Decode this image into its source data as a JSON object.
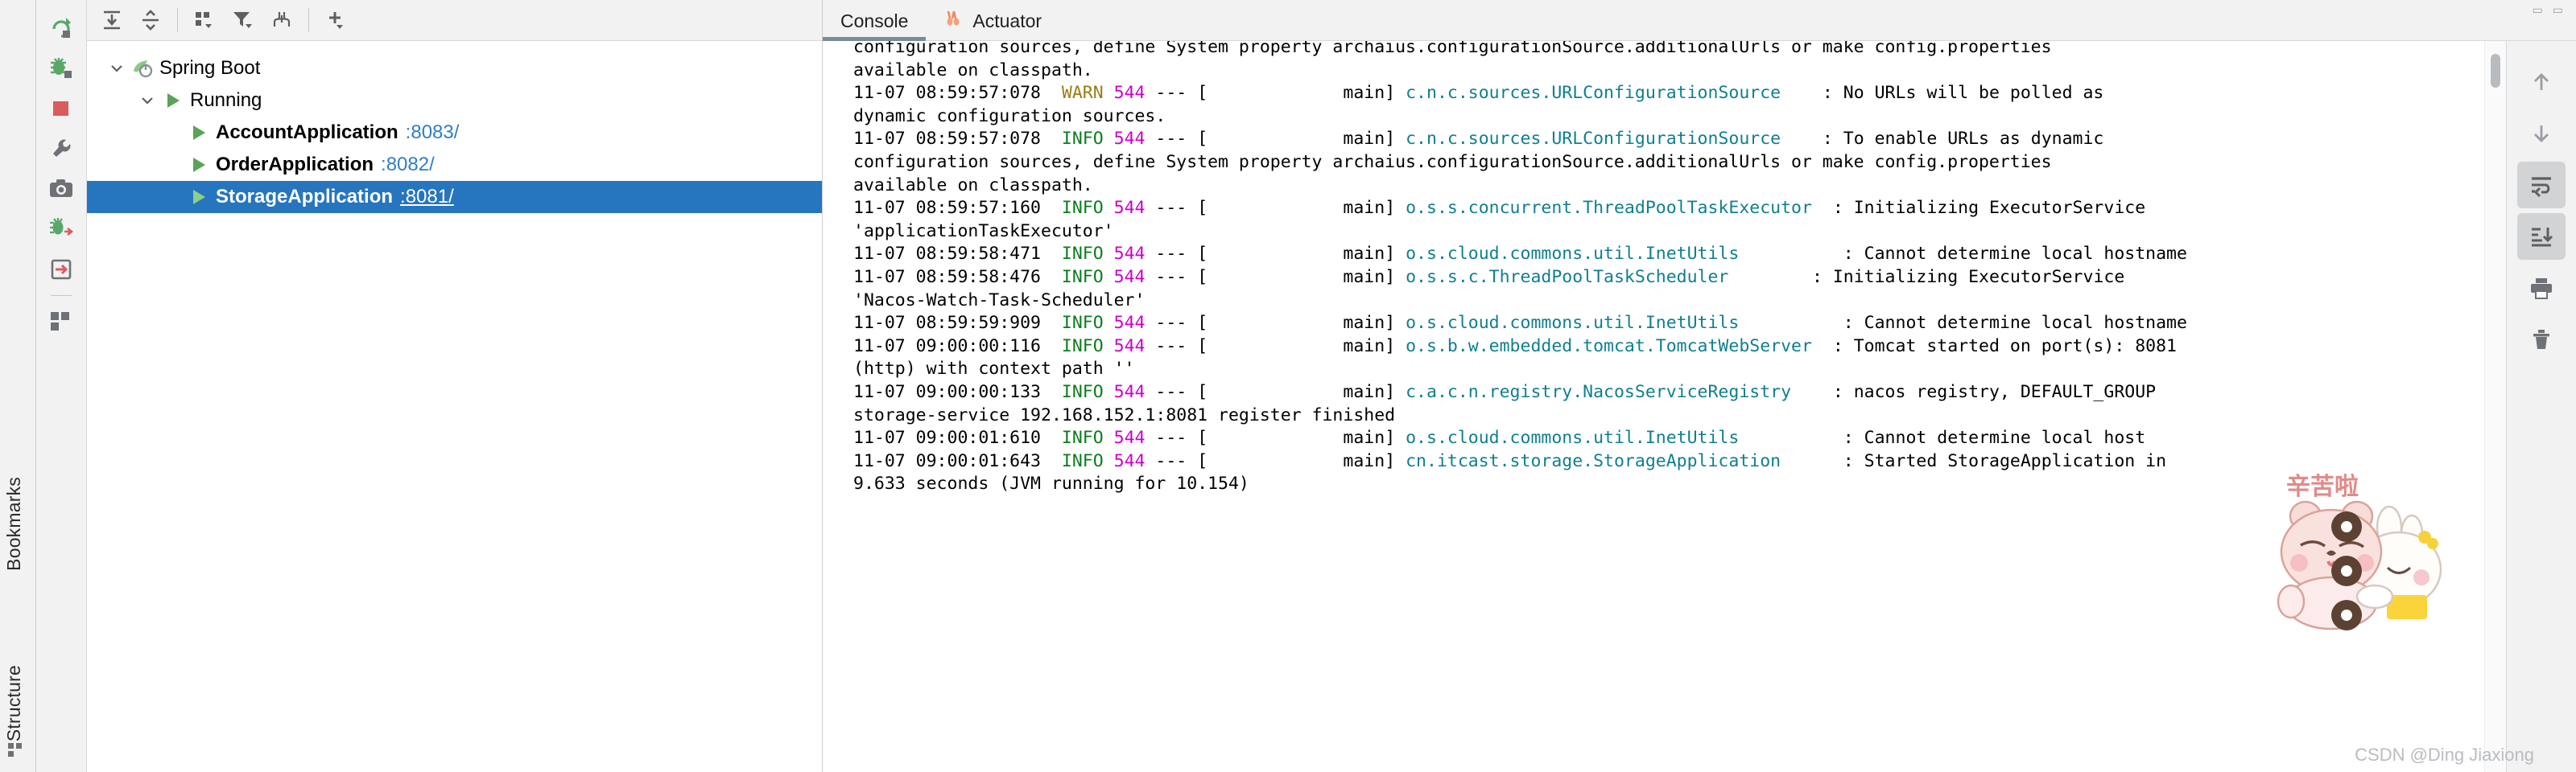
{
  "left_strip": {
    "labels": [
      {
        "name": "bookmarks",
        "text": "Bookmarks"
      },
      {
        "name": "structure",
        "text": "Structure"
      }
    ]
  },
  "run_toolbar": {
    "buttons": [
      {
        "name": "rerun-button",
        "icon": "rerun-icon",
        "tooltip": "Rerun"
      },
      {
        "name": "debug-button",
        "icon": "debug-icon",
        "tooltip": "Debug"
      },
      {
        "name": "stop-button",
        "icon": "stop-icon",
        "tooltip": "Stop"
      },
      {
        "name": "settings-button",
        "icon": "wrench-icon",
        "tooltip": "Settings"
      },
      {
        "name": "camera-button",
        "icon": "camera-icon",
        "tooltip": "Take Snapshot"
      },
      {
        "name": "debug-all-button",
        "icon": "debug-step-icon",
        "tooltip": "Debug All"
      },
      {
        "name": "exit-button",
        "icon": "exit-icon",
        "tooltip": "Exit"
      },
      {
        "name": "layout-button",
        "icon": "layout-icon",
        "tooltip": "Layout"
      }
    ]
  },
  "tree_toolbar": {
    "buttons": [
      {
        "name": "expand-all-button",
        "icon": "expand-all-icon"
      },
      {
        "name": "collapse-all-button",
        "icon": "collapse-all-icon"
      },
      {
        "name": "group-by-button",
        "icon": "group-by-icon"
      },
      {
        "name": "filter-button",
        "icon": "filter-icon"
      },
      {
        "name": "add-tab-button",
        "icon": "add-frame-icon"
      },
      {
        "name": "add-configuration-button",
        "icon": "plus-icon"
      }
    ]
  },
  "service_tree": {
    "nodes": [
      {
        "name": "spring-boot-node",
        "label": "Spring Boot",
        "port": "",
        "indent": 0,
        "expanded": true,
        "has_chevron": true,
        "icon": "spring-boot-icon",
        "bold": false,
        "selected": false
      },
      {
        "name": "running-node",
        "label": "Running",
        "port": "",
        "indent": 1,
        "expanded": true,
        "has_chevron": true,
        "icon": "run-triangle-icon",
        "bold": false,
        "selected": false
      },
      {
        "name": "account-application-node",
        "label": "AccountApplication",
        "port": ":8083/",
        "indent": 2,
        "expanded": false,
        "has_chevron": false,
        "icon": "run-triangle-icon",
        "bold": true,
        "selected": false
      },
      {
        "name": "order-application-node",
        "label": "OrderApplication",
        "port": ":8082/",
        "indent": 2,
        "expanded": false,
        "has_chevron": false,
        "icon": "run-triangle-icon",
        "bold": true,
        "selected": false
      },
      {
        "name": "storage-application-node",
        "label": "StorageApplication",
        "port": ":8081/",
        "indent": 2,
        "expanded": false,
        "has_chevron": false,
        "icon": "run-triangle-icon",
        "bold": true,
        "selected": true
      }
    ]
  },
  "tabs": [
    {
      "name": "tab-console",
      "label": "Console",
      "icon": "",
      "active": true
    },
    {
      "name": "tab-actuator",
      "label": "Actuator",
      "icon": "actuator-icon",
      "active": false
    }
  ],
  "console": {
    "lines": [
      {
        "type": "wrap-cut",
        "text": "configuration sources, define System property archaius.configurationSource.additionalUrls or make config.properties"
      },
      {
        "type": "wrap",
        "text": "available on classpath."
      },
      {
        "type": "entry",
        "ts": "11-07 08:59:57:078",
        "level": "WARN",
        "pid": "544",
        "thread": "main]",
        "logger": "c.n.c.sources.URLConfigurationSource",
        "message": ": No URLs will be polled as"
      },
      {
        "type": "wrap",
        "text": "dynamic configuration sources."
      },
      {
        "type": "entry",
        "ts": "11-07 08:59:57:078",
        "level": "INFO",
        "pid": "544",
        "thread": "main]",
        "logger": "c.n.c.sources.URLConfigurationSource",
        "message": ": To enable URLs as dynamic"
      },
      {
        "type": "wrap",
        "text": "configuration sources, define System property archaius.configurationSource.additionalUrls or make config.properties"
      },
      {
        "type": "wrap",
        "text": "available on classpath."
      },
      {
        "type": "entry",
        "ts": "11-07 08:59:57:160",
        "level": "INFO",
        "pid": "544",
        "thread": "main]",
        "logger": "o.s.s.concurrent.ThreadPoolTaskExecutor",
        "message": ": Initializing ExecutorService"
      },
      {
        "type": "wrap",
        "text": "'applicationTaskExecutor'"
      },
      {
        "type": "entry",
        "ts": "11-07 08:59:58:471",
        "level": "INFO",
        "pid": "544",
        "thread": "main]",
        "logger": "o.s.cloud.commons.util.InetUtils",
        "message": ": Cannot determine local hostname"
      },
      {
        "type": "entry",
        "ts": "11-07 08:59:58:476",
        "level": "INFO",
        "pid": "544",
        "thread": "main]",
        "logger": "o.s.s.c.ThreadPoolTaskScheduler",
        "message": ": Initializing ExecutorService"
      },
      {
        "type": "wrap",
        "text": "'Nacos-Watch-Task-Scheduler'"
      },
      {
        "type": "entry",
        "ts": "11-07 08:59:59:909",
        "level": "INFO",
        "pid": "544",
        "thread": "main]",
        "logger": "o.s.cloud.commons.util.InetUtils",
        "message": ": Cannot determine local hostname"
      },
      {
        "type": "entry",
        "ts": "11-07 09:00:00:116",
        "level": "INFO",
        "pid": "544",
        "thread": "main]",
        "logger": "o.s.b.w.embedded.tomcat.TomcatWebServer",
        "message": ": Tomcat started on port(s): 8081"
      },
      {
        "type": "wrap",
        "text": "(http) with context path ''"
      },
      {
        "type": "entry",
        "ts": "11-07 09:00:00:133",
        "level": "INFO",
        "pid": "544",
        "thread": "main]",
        "logger": "c.a.c.n.registry.NacosServiceRegistry",
        "message": ": nacos registry, DEFAULT_GROUP"
      },
      {
        "type": "wrap",
        "text": "storage-service 192.168.152.1:8081 register finished"
      },
      {
        "type": "entry",
        "ts": "11-07 09:00:01:610",
        "level": "INFO",
        "pid": "544",
        "thread": "main]",
        "logger": "o.s.cloud.commons.util.InetUtils",
        "message": ": Cannot determine local host"
      },
      {
        "type": "entry",
        "ts": "11-07 09:00:01:643",
        "level": "INFO",
        "pid": "544",
        "thread": "main]",
        "logger": "cn.itcast.storage.StorageApplication",
        "message": ": Started StorageApplication in"
      },
      {
        "type": "wrap",
        "text": "9.633 seconds (JVM running for 10.154)"
      }
    ]
  },
  "console_gutter": {
    "buttons": [
      {
        "name": "scroll-up-button",
        "icon": "arrow-up-icon",
        "active": false
      },
      {
        "name": "scroll-down-button",
        "icon": "arrow-down-icon",
        "active": false
      },
      {
        "name": "soft-wrap-button",
        "icon": "soft-wrap-icon",
        "active": true
      },
      {
        "name": "scroll-to-end-button",
        "icon": "scroll-to-end-icon",
        "active": true
      },
      {
        "name": "print-button",
        "icon": "printer-icon",
        "active": false
      },
      {
        "name": "clear-all-button",
        "icon": "trash-icon",
        "active": false
      }
    ]
  },
  "overlay": {
    "sticker_text": "辛苦啦",
    "watermark": "CSDN @Ding Jiaxiong"
  },
  "colors": {
    "selection": "#2675bf",
    "link": "#2f7ec6",
    "logger": "#0f7f8f",
    "info": "#0a7d1c",
    "warn": "#9a7d14",
    "pid": "#cc00cc",
    "toolbar_bg": "#f2f2f2"
  }
}
